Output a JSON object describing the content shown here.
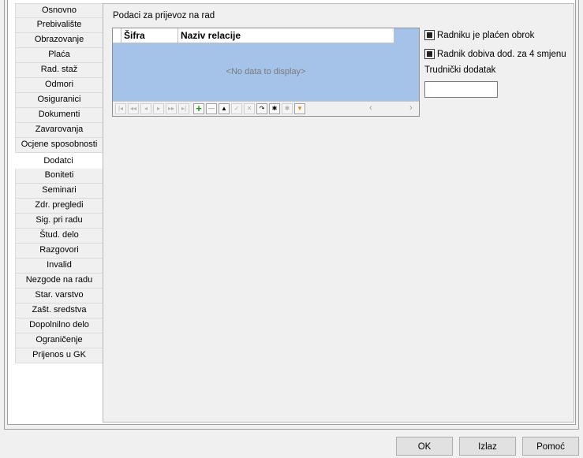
{
  "tabs": [
    {
      "label": "Osnovno"
    },
    {
      "label": "Prebivalište"
    },
    {
      "label": "Obrazovanje"
    },
    {
      "label": "Plaća"
    },
    {
      "label": "Rad. staž"
    },
    {
      "label": "Odmori"
    },
    {
      "label": "Osiguranici"
    },
    {
      "label": "Dokumenti"
    },
    {
      "label": "Zavarovanja"
    },
    {
      "label": "Ocjene sposobnosti"
    },
    {
      "label": "Dodatci"
    },
    {
      "label": "Boniteti"
    },
    {
      "label": "Seminari"
    },
    {
      "label": "Zdr. pregledi"
    },
    {
      "label": "Sig. pri radu"
    },
    {
      "label": "Štud. delo"
    },
    {
      "label": "Razgovori"
    },
    {
      "label": "Invalid"
    },
    {
      "label": "Nezgode na radu"
    },
    {
      "label": "Star. varstvo"
    },
    {
      "label": "Zašt. sredstva"
    },
    {
      "label": "Dopolnilno delo"
    },
    {
      "label": "Ograničenje"
    },
    {
      "label": "Prijenos u GK"
    }
  ],
  "active_tab": "Dodatci",
  "content": {
    "section_title": "Podaci za prijevoz na rad",
    "grid": {
      "columns": [
        "Šifra",
        "Naziv relacije"
      ],
      "empty_text": "<No data to display>"
    },
    "navigator_icons": [
      "first",
      "prev-page",
      "prev",
      "next",
      "next-page",
      "last",
      "insert",
      "delete",
      "edit",
      "post",
      "cancel",
      "refresh",
      "save-bookmark",
      "goto-bookmark",
      "filter"
    ],
    "checkboxes": [
      {
        "label": "Radniku je plaćen obrok",
        "checked": true
      },
      {
        "label": "Radnik dobiva dod. za 4 smjenu",
        "checked": true
      }
    ],
    "trudnicki_label": "Trudnički dodatak",
    "trudnicki_value": ""
  },
  "buttons": {
    "ok": "OK",
    "izlaz": "Izlaz",
    "pomoc": "Pomoć"
  }
}
